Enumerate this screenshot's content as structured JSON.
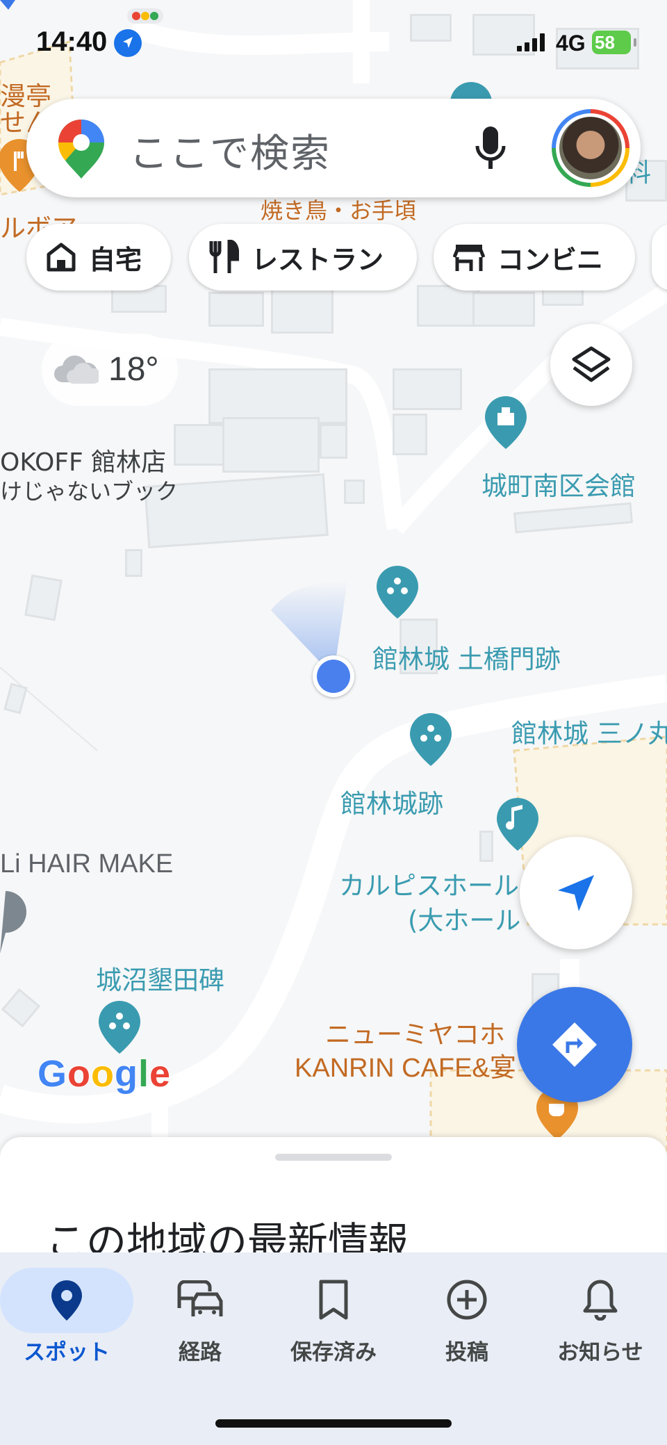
{
  "status_bar": {
    "time": "14:40",
    "network": "4G",
    "battery": "58"
  },
  "search": {
    "placeholder": "ここで検索"
  },
  "chips": [
    {
      "label": "自宅",
      "icon": "home-icon"
    },
    {
      "label": "レストラン",
      "icon": "restaurant-icon"
    },
    {
      "label": "コンビニ",
      "icon": "store-icon"
    }
  ],
  "weather": {
    "temperature": "18°",
    "icon": "cloud-icon"
  },
  "map_labels": {
    "yakitori": "焼き鳥・お手頃",
    "bookoff_1": "OKOFF 館林店",
    "bookoff_2": "けじゃないブック",
    "jomachi": "城町南区会館",
    "dobashi": "館林城 土橋門跡",
    "sannomaru": "館林城 三ノ丸",
    "castle_ruins": "館林城跡",
    "calpis_1": "カルピスホール",
    "calpis_2": "(大ホール",
    "hair": "Li HAIR MAKE",
    "jonuma": "城沼墾田碑",
    "newmiyako": "ニューミヤコホ",
    "kanrin": "KANRIN CAFE&宴",
    "edge_top_1": "漫亭",
    "edge_top_2": "せん",
    "edge_top_3": "ルボア",
    "edge_right": "料"
  },
  "google_logo": "Google",
  "sheet": {
    "title": "この地域の最新情報"
  },
  "nav": [
    {
      "label": "スポット",
      "icon": "pin-icon",
      "active": true
    },
    {
      "label": "経路",
      "icon": "commute-icon",
      "active": false
    },
    {
      "label": "保存済み",
      "icon": "bookmark-icon",
      "active": false
    },
    {
      "label": "投稿",
      "icon": "add-circle-icon",
      "active": false
    },
    {
      "label": "お知らせ",
      "icon": "bell-icon",
      "active": false
    }
  ],
  "colors": {
    "accent": "#3b78e7",
    "teal_poi": "#3a9bb0",
    "orange_poi": "#c26a23",
    "nav_active": "#d3e3fd"
  }
}
